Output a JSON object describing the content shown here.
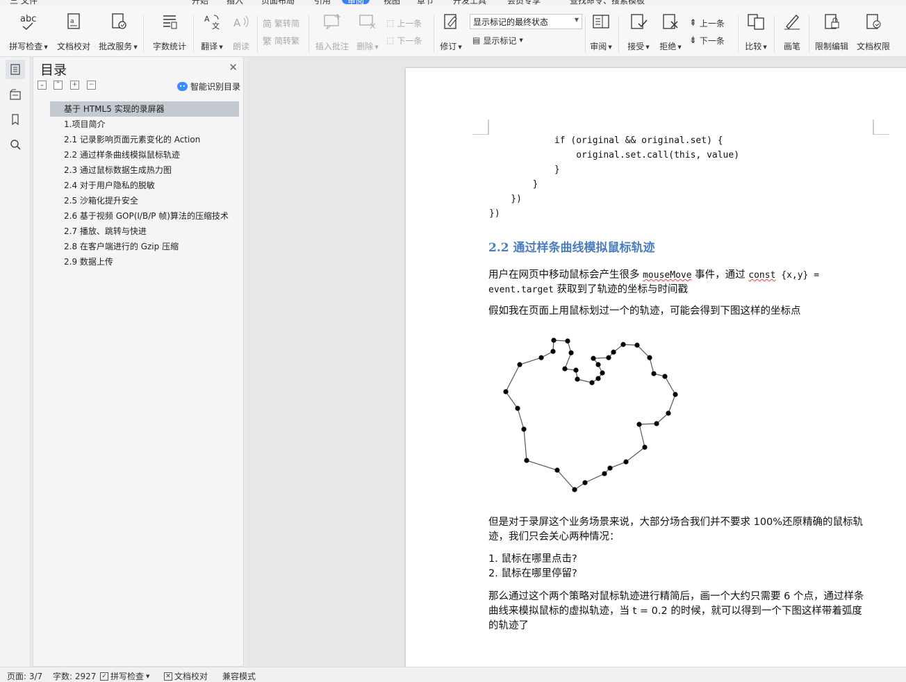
{
  "menu": {
    "items": [
      "三 文件",
      "开始",
      "插入",
      "页面布局",
      "引用",
      "审阅",
      "视图",
      "章节",
      "开发工具",
      "会员专享",
      "查找命令、搜索模板"
    ],
    "active": "审阅"
  },
  "ribbon": {
    "spell_check": "拼写检查",
    "doc_proof": "文档校对",
    "batch_service": "批改服务",
    "word_count": "字数统计",
    "translate": "翻译",
    "read_aloud": "朗读",
    "trad_to_simp": "繁转简",
    "simp_to_trad": "简转繁",
    "insert_comment": "插入批注",
    "delete": "删除",
    "prev_comment": "上一条",
    "next_comment": "下一条",
    "revise": "修订",
    "markup_mode": "显示标记的最终状态",
    "show_markup": "显示标记",
    "review": "审阅",
    "accept": "接受",
    "reject": "拒绝",
    "prev_change": "上一条",
    "next_change": "下一条",
    "compare": "比较",
    "ink": "画笔",
    "restrict_edit": "限制编辑",
    "doc_rights": "文档权限",
    "abc": "abc"
  },
  "toc": {
    "title": "目录",
    "smart_label": "智能识别目录",
    "items": [
      "基于 HTML5 实现的录屏器",
      "1.项目简介",
      "2.1 记录影响页面元素变化的 Action",
      "2.2 通过样条曲线模拟鼠标轨迹",
      "2.3 通过鼠标数据生成热力图",
      "2.4 对于用户隐私的脱敏",
      "2.5 沙箱化提升安全",
      "2.6 基于视频 GOP(I/B/P 帧)算法的压缩技术",
      "2.7 播放、跳转与快进",
      "2.8 在客户端进行的 Gzip 压缩",
      "2.9 数据上传"
    ],
    "selected_index": 0
  },
  "document": {
    "code_lines": [
      "            if (original && original.set) {",
      "                original.set.call(this, value)",
      "            }",
      "        }",
      "    })",
      "})"
    ],
    "heading": "2.2 通过样条曲线模拟鼠标轨迹",
    "para1_a": "用户在网页中移动鼠标会产生很多 ",
    "para1_code1": "mouseMove",
    "para1_b": " 事件，通过 ",
    "para1_code2": "const",
    "para1_code3": " {x,y} = event.target",
    "para1_c": " 获取到了轨迹的坐标与时间戳",
    "para2": "假如我在页面上用鼠标划过一个的轨迹，可能会得到下图这样的坐标点",
    "para3": "但是对于录屏这个业务场景来说，大部分场合我们并不要求 100%还原精确的鼠标轨迹，我们只会关心两种情况：",
    "list": [
      "1.  鼠标在哪里点击?",
      "2.  鼠标在哪里停留?"
    ],
    "para4": "那么通过这个两个策略对鼠标轨迹进行精简后，画一个大约只需要 6 个点，通过样条曲线来模拟鼠标的虚拟轨迹，当 t = 0.2 的时候，就可以得到一个下图这样带着弧度的轨迹了"
  },
  "status": {
    "page": "页面: 3/7",
    "words": "字数: 2927",
    "spell": "拼写检查",
    "proof": "文档校对",
    "compat": "兼容模式"
  }
}
